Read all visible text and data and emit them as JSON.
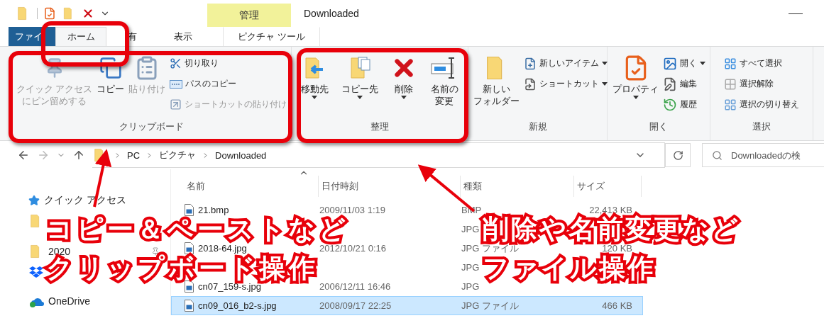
{
  "title_bar": {
    "title": "Downloaded",
    "context_label": "管理"
  },
  "tabs": [
    {
      "label": "ファイ",
      "kind": "file",
      "selected": false
    },
    {
      "label": "ホーム",
      "kind": "normal",
      "selected": true
    },
    {
      "label": "有",
      "kind": "normal",
      "selected": false
    },
    {
      "label": "表示",
      "kind": "normal",
      "selected": false
    },
    {
      "label": "ピクチャ ツール",
      "kind": "context",
      "selected": false
    }
  ],
  "ribbon": {
    "groups": [
      {
        "label": "クリップボード",
        "items": [
          {
            "kind": "large",
            "lines": [
              "クイック アクセス",
              "にピン留めする"
            ],
            "disabled": true,
            "has_menu": false
          },
          {
            "kind": "large",
            "lines": [
              "コピー"
            ],
            "disabled": false,
            "has_menu": false
          },
          {
            "kind": "large",
            "lines": [
              "貼り付け"
            ],
            "disabled": true,
            "has_menu": false
          },
          {
            "kind": "small",
            "label": "切り取り",
            "disabled": false,
            "has_menu": false
          },
          {
            "kind": "small",
            "label": "パスのコピー",
            "disabled": false,
            "has_menu": false
          },
          {
            "kind": "small",
            "label": "ショートカットの貼り付け",
            "disabled": true,
            "has_menu": false
          }
        ]
      },
      {
        "label": "整理",
        "items": [
          {
            "kind": "large",
            "lines": [
              "移動先"
            ],
            "disabled": false,
            "has_menu": true
          },
          {
            "kind": "large",
            "lines": [
              "コピー先"
            ],
            "disabled": false,
            "has_menu": true
          },
          {
            "kind": "large",
            "lines": [
              "削除"
            ],
            "disabled": false,
            "has_menu": true
          },
          {
            "kind": "large",
            "lines": [
              "名前の",
              "変更"
            ],
            "disabled": false,
            "has_menu": false
          }
        ]
      },
      {
        "label": "新規",
        "items": [
          {
            "kind": "large",
            "lines": [
              "新しい",
              "フォルダー"
            ],
            "disabled": false,
            "has_menu": false
          },
          {
            "kind": "small",
            "label": "新しいアイテム",
            "disabled": false,
            "has_menu": true
          },
          {
            "kind": "small",
            "label": "ショートカット",
            "disabled": false,
            "has_menu": true
          }
        ]
      },
      {
        "label": "開く",
        "items": [
          {
            "kind": "large",
            "lines": [
              "プロパティ"
            ],
            "disabled": false,
            "has_menu": true
          },
          {
            "kind": "small",
            "label": "開く",
            "disabled": false,
            "has_menu": true
          },
          {
            "kind": "small",
            "label": "編集",
            "disabled": false,
            "has_menu": false
          },
          {
            "kind": "small",
            "label": "履歴",
            "disabled": false,
            "has_menu": false
          }
        ]
      },
      {
        "label": "選択",
        "items": [
          {
            "kind": "small",
            "label": "すべて選択",
            "disabled": false,
            "has_menu": false
          },
          {
            "kind": "small",
            "label": "選択解除",
            "disabled": false,
            "has_menu": false
          },
          {
            "kind": "small",
            "label": "選択の切り替え",
            "disabled": false,
            "has_menu": false
          }
        ]
      }
    ]
  },
  "address_bar": {
    "crumbs": [
      "PC",
      "ピクチャ",
      "Downloaded"
    ],
    "search_placeholder": "Downloadedの検"
  },
  "nav_pane": [
    {
      "kind": "quick",
      "label": "クイック アクセス"
    },
    {
      "kind": "folder"
    },
    {
      "kind": "folder",
      "label": "2020",
      "pinned": true
    },
    {
      "kind": "dropbox"
    },
    {
      "kind": "onedrive",
      "label": "OneDrive"
    }
  ],
  "file_list": {
    "columns": [
      "名前",
      "日付時刻",
      "種類",
      "サイズ"
    ],
    "rows": [
      {
        "name": "21.bmp",
        "date": "2009/11/03 1:19",
        "type": "BMP",
        "size": "22,413 KB",
        "selected": false
      },
      {
        "type": "JPG",
        "selected": false
      },
      {
        "name": "2018-64.jpg",
        "date": "2012/10/21 0:16",
        "type": "JPG ファイル",
        "size": "120 KB",
        "selected": false
      },
      {
        "type": "JPG",
        "selected": false
      },
      {
        "name": "cn07_159-s.jpg",
        "date": "2006/12/11 16:46",
        "type": "JPG",
        "selected": false
      },
      {
        "name": "cn09_016_b2-s.jpg",
        "date": "2008/09/17 22:25",
        "type": "JPG ファイル",
        "size": "466 KB",
        "selected": true
      }
    ]
  },
  "annotations": [
    {
      "lines": [
        "コピー＆ペーストなど",
        "クリップボード操作"
      ]
    },
    {
      "lines": [
        "削除や名前変更など",
        "ファイル操作"
      ]
    }
  ]
}
